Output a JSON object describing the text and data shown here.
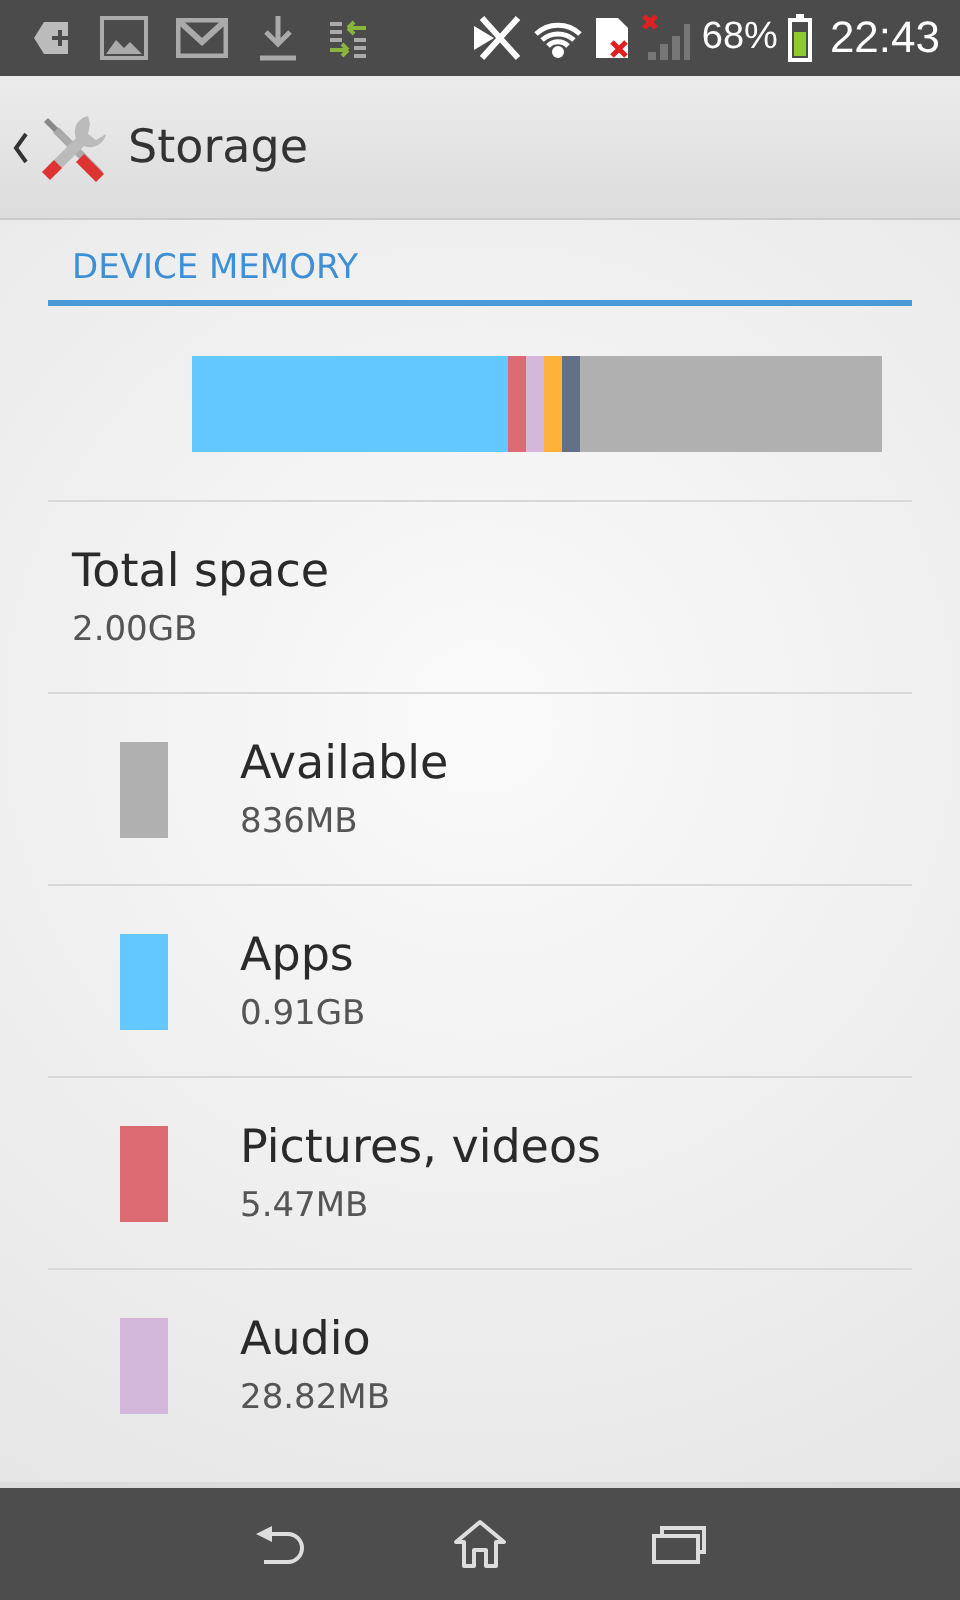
{
  "status_bar": {
    "battery": "68%",
    "time": "22:43"
  },
  "action_bar": {
    "title": "Storage"
  },
  "section": {
    "title": "DEVICE MEMORY"
  },
  "usage_bar": [
    {
      "color": "#62c8ff"
    },
    {
      "color": "#dc6a72"
    },
    {
      "color": "#d4b8dc"
    },
    {
      "color": "#ffb23a"
    },
    {
      "color": "#637085"
    },
    {
      "color": "#b0b0b0"
    }
  ],
  "total": {
    "label": "Total space",
    "value": "2.00GB"
  },
  "categories": [
    {
      "label": "Available",
      "value": "836MB",
      "color": "#b0b0b0"
    },
    {
      "label": "Apps",
      "value": "0.91GB",
      "color": "#62c8ff"
    },
    {
      "label": "Pictures, videos",
      "value": "5.47MB",
      "color": "#dc6a72"
    },
    {
      "label": "Audio",
      "value": "28.82MB",
      "color": "#d4b8dc"
    }
  ]
}
